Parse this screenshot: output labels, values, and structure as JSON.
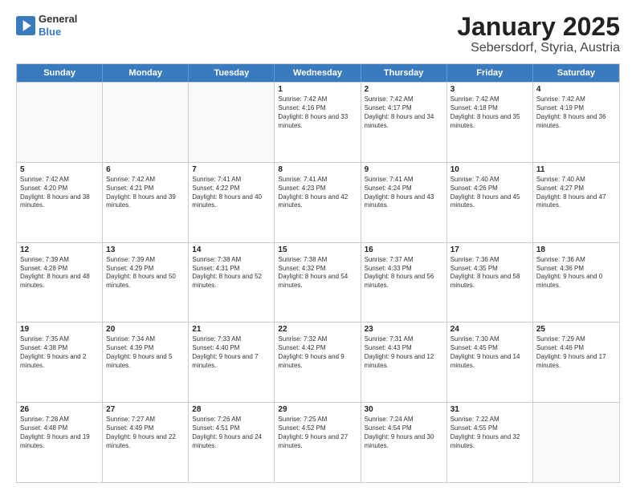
{
  "header": {
    "logo": {
      "general": "General",
      "blue": "Blue"
    },
    "title": "January 2025",
    "subtitle": "Sebersdorf, Styria, Austria"
  },
  "days": [
    "Sunday",
    "Monday",
    "Tuesday",
    "Wednesday",
    "Thursday",
    "Friday",
    "Saturday"
  ],
  "weeks": [
    [
      {
        "day": "",
        "empty": true
      },
      {
        "day": "",
        "empty": true
      },
      {
        "day": "",
        "empty": true
      },
      {
        "day": "1",
        "sunrise": "7:42 AM",
        "sunset": "4:16 PM",
        "daylight": "8 hours and 33 minutes."
      },
      {
        "day": "2",
        "sunrise": "7:42 AM",
        "sunset": "4:17 PM",
        "daylight": "8 hours and 34 minutes."
      },
      {
        "day": "3",
        "sunrise": "7:42 AM",
        "sunset": "4:18 PM",
        "daylight": "8 hours and 35 minutes."
      },
      {
        "day": "4",
        "sunrise": "7:42 AM",
        "sunset": "4:19 PM",
        "daylight": "8 hours and 36 minutes."
      }
    ],
    [
      {
        "day": "5",
        "sunrise": "7:42 AM",
        "sunset": "4:20 PM",
        "daylight": "8 hours and 38 minutes."
      },
      {
        "day": "6",
        "sunrise": "7:42 AM",
        "sunset": "4:21 PM",
        "daylight": "8 hours and 39 minutes."
      },
      {
        "day": "7",
        "sunrise": "7:41 AM",
        "sunset": "4:22 PM",
        "daylight": "8 hours and 40 minutes."
      },
      {
        "day": "8",
        "sunrise": "7:41 AM",
        "sunset": "4:23 PM",
        "daylight": "8 hours and 42 minutes."
      },
      {
        "day": "9",
        "sunrise": "7:41 AM",
        "sunset": "4:24 PM",
        "daylight": "8 hours and 43 minutes."
      },
      {
        "day": "10",
        "sunrise": "7:40 AM",
        "sunset": "4:26 PM",
        "daylight": "8 hours and 45 minutes."
      },
      {
        "day": "11",
        "sunrise": "7:40 AM",
        "sunset": "4:27 PM",
        "daylight": "8 hours and 47 minutes."
      }
    ],
    [
      {
        "day": "12",
        "sunrise": "7:39 AM",
        "sunset": "4:28 PM",
        "daylight": "8 hours and 48 minutes."
      },
      {
        "day": "13",
        "sunrise": "7:39 AM",
        "sunset": "4:29 PM",
        "daylight": "8 hours and 50 minutes."
      },
      {
        "day": "14",
        "sunrise": "7:38 AM",
        "sunset": "4:31 PM",
        "daylight": "8 hours and 52 minutes."
      },
      {
        "day": "15",
        "sunrise": "7:38 AM",
        "sunset": "4:32 PM",
        "daylight": "8 hours and 54 minutes."
      },
      {
        "day": "16",
        "sunrise": "7:37 AM",
        "sunset": "4:33 PM",
        "daylight": "8 hours and 56 minutes."
      },
      {
        "day": "17",
        "sunrise": "7:36 AM",
        "sunset": "4:35 PM",
        "daylight": "8 hours and 58 minutes."
      },
      {
        "day": "18",
        "sunrise": "7:36 AM",
        "sunset": "4:36 PM",
        "daylight": "9 hours and 0 minutes."
      }
    ],
    [
      {
        "day": "19",
        "sunrise": "7:35 AM",
        "sunset": "4:38 PM",
        "daylight": "9 hours and 2 minutes."
      },
      {
        "day": "20",
        "sunrise": "7:34 AM",
        "sunset": "4:39 PM",
        "daylight": "9 hours and 5 minutes."
      },
      {
        "day": "21",
        "sunrise": "7:33 AM",
        "sunset": "4:40 PM",
        "daylight": "9 hours and 7 minutes."
      },
      {
        "day": "22",
        "sunrise": "7:32 AM",
        "sunset": "4:42 PM",
        "daylight": "9 hours and 9 minutes."
      },
      {
        "day": "23",
        "sunrise": "7:31 AM",
        "sunset": "4:43 PM",
        "daylight": "9 hours and 12 minutes."
      },
      {
        "day": "24",
        "sunrise": "7:30 AM",
        "sunset": "4:45 PM",
        "daylight": "9 hours and 14 minutes."
      },
      {
        "day": "25",
        "sunrise": "7:29 AM",
        "sunset": "4:46 PM",
        "daylight": "9 hours and 17 minutes."
      }
    ],
    [
      {
        "day": "26",
        "sunrise": "7:28 AM",
        "sunset": "4:48 PM",
        "daylight": "9 hours and 19 minutes."
      },
      {
        "day": "27",
        "sunrise": "7:27 AM",
        "sunset": "4:49 PM",
        "daylight": "9 hours and 22 minutes."
      },
      {
        "day": "28",
        "sunrise": "7:26 AM",
        "sunset": "4:51 PM",
        "daylight": "9 hours and 24 minutes."
      },
      {
        "day": "29",
        "sunrise": "7:25 AM",
        "sunset": "4:52 PM",
        "daylight": "9 hours and 27 minutes."
      },
      {
        "day": "30",
        "sunrise": "7:24 AM",
        "sunset": "4:54 PM",
        "daylight": "9 hours and 30 minutes."
      },
      {
        "day": "31",
        "sunrise": "7:22 AM",
        "sunset": "4:55 PM",
        "daylight": "9 hours and 32 minutes."
      },
      {
        "day": "",
        "empty": true
      }
    ]
  ]
}
